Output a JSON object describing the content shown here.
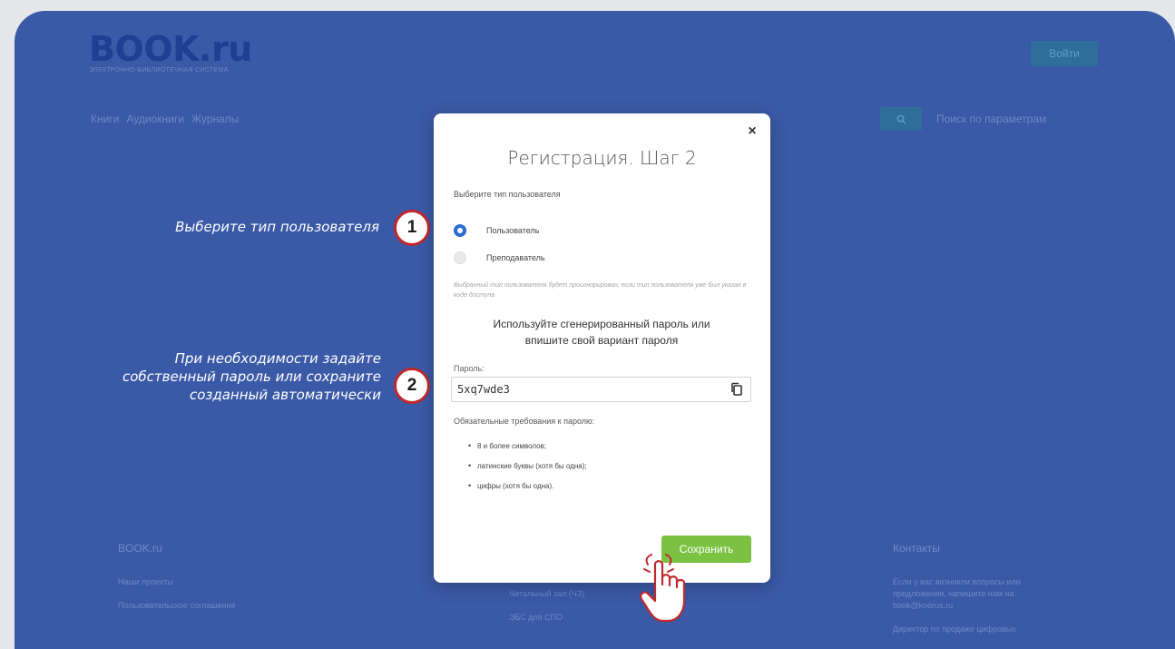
{
  "page": {
    "logo_title": "BOOK.ru",
    "logo_subtitle": "ЭЛЕКТРОННО-БИБЛИОТЕЧНАЯ СИСТЕМА",
    "login_label": "Войти",
    "nav": [
      "Книги",
      "Аудиокниги",
      "Журналы"
    ],
    "param_search": "Поиск по параметрам",
    "footer": {
      "col1": {
        "heading": "BOOK.ru",
        "items": [
          "Наши проекты",
          "Пользовательское соглашение"
        ]
      },
      "col2": {
        "items": [
          "Читальный зал (ЧЗ)",
          "ЭБС для СПО"
        ]
      },
      "col3": {
        "heading": "Контакты",
        "text": "Если у вас возникли вопросы или предложения, напишите нам на book@knorus.ru",
        "text2": "Директор по продаже цифровых"
      }
    }
  },
  "annotations": [
    {
      "number": "1",
      "text": "Выберите тип пользователя"
    },
    {
      "number": "2",
      "text": "При необходимости задайте собственный пароль или сохраните созданный автоматически"
    }
  ],
  "modal": {
    "close": "×",
    "title": "Регистрация. Шаг 2",
    "user_type_label": "Выберите тип пользователя",
    "options": [
      {
        "label": "Пользователь",
        "selected": true
      },
      {
        "label": "Преподаватель",
        "selected": false
      }
    ],
    "note": "Выбранный тип пользователя будет проигнорирован, если тип пользователя уже был указан в коде доступа",
    "hint": "Используйте сгенерированный пароль или впишите свой вариант пароля",
    "password_label": "Пароль:",
    "password_value": "5xq7wde3",
    "requirements_title": "Обязательные требования к паролю:",
    "requirements": [
      "8 и более символов;",
      "латинские буквы (хотя бы одна);",
      "цифры (хотя бы одна)."
    ],
    "save_label": "Сохранить"
  },
  "colors": {
    "backdrop": "#3a59a6",
    "primary": "#2b6cd4",
    "save": "#7bc242",
    "annotation_ring": "#c0282d"
  }
}
